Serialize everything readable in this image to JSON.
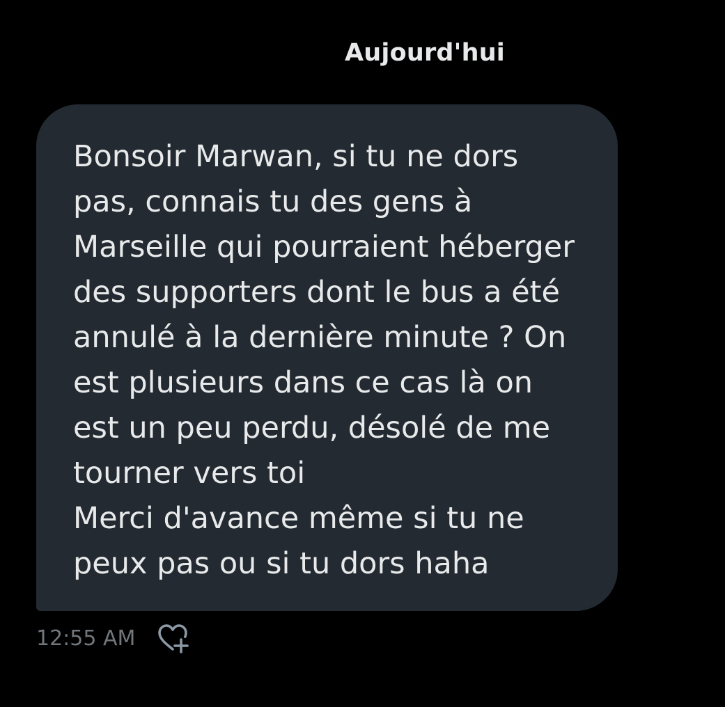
{
  "conversation": {
    "date_separator": "Aujourd'hui",
    "messages": [
      {
        "text": "Bonsoir Marwan, si tu ne dors\npas, connais tu des gens à\nMarseille qui pourraient héberger\ndes supporters dont le bus a été\nannulé à la dernière minute ? On\nest plusieurs dans ce cas là on\nest un peu perdu, désolé de me\ntourner vers toi\nMerci d'avance même si tu ne\npeux pas ou si tu dors haha",
        "timestamp": "12:55 AM",
        "reaction_icon": "heart-plus-icon"
      }
    ]
  },
  "colors": {
    "background": "#000000",
    "bubble": "#232a31",
    "text": "#e7e9ea",
    "muted": "#71767b"
  }
}
